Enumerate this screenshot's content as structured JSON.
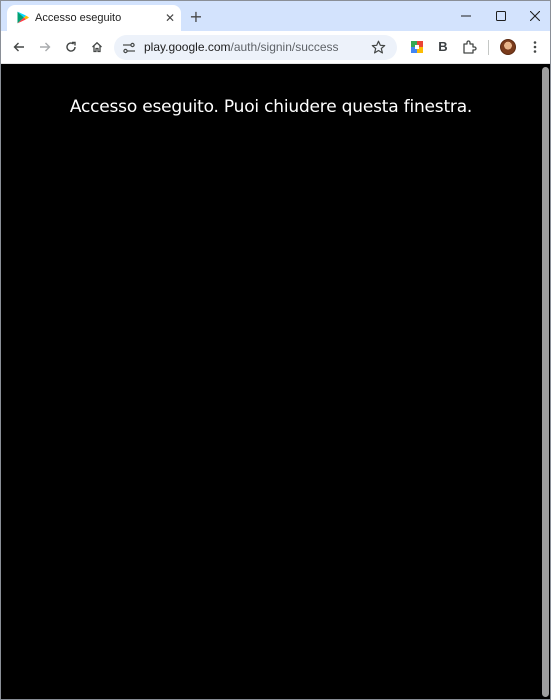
{
  "tab": {
    "title": "Accesso eseguito",
    "close_glyph": "✕",
    "favicon": "google-play-icon"
  },
  "new_tab_glyph": "+",
  "window_controls": {
    "minimize": "minimize-icon",
    "maximize": "maximize-icon",
    "close": "close-window-icon"
  },
  "toolbar": {
    "back": "back-arrow-icon",
    "forward": "forward-arrow-icon",
    "reload": "reload-icon",
    "home": "home-icon",
    "site_info": "site-info-icon",
    "bookmark": "star-icon",
    "extensions": "puzzle-icon",
    "menu": "kebab-menu-icon",
    "ext_b_label": "B"
  },
  "omnibox": {
    "domain": "play.google.com",
    "path": "/auth/signin/success"
  },
  "content": {
    "message": "Accesso eseguito. Puoi chiudere questa finestra."
  },
  "colors": {
    "tabstrip": "#d3e3fd",
    "omnibox": "#edf2fa",
    "page_background": "#000000",
    "message_text": "#ffffff"
  }
}
